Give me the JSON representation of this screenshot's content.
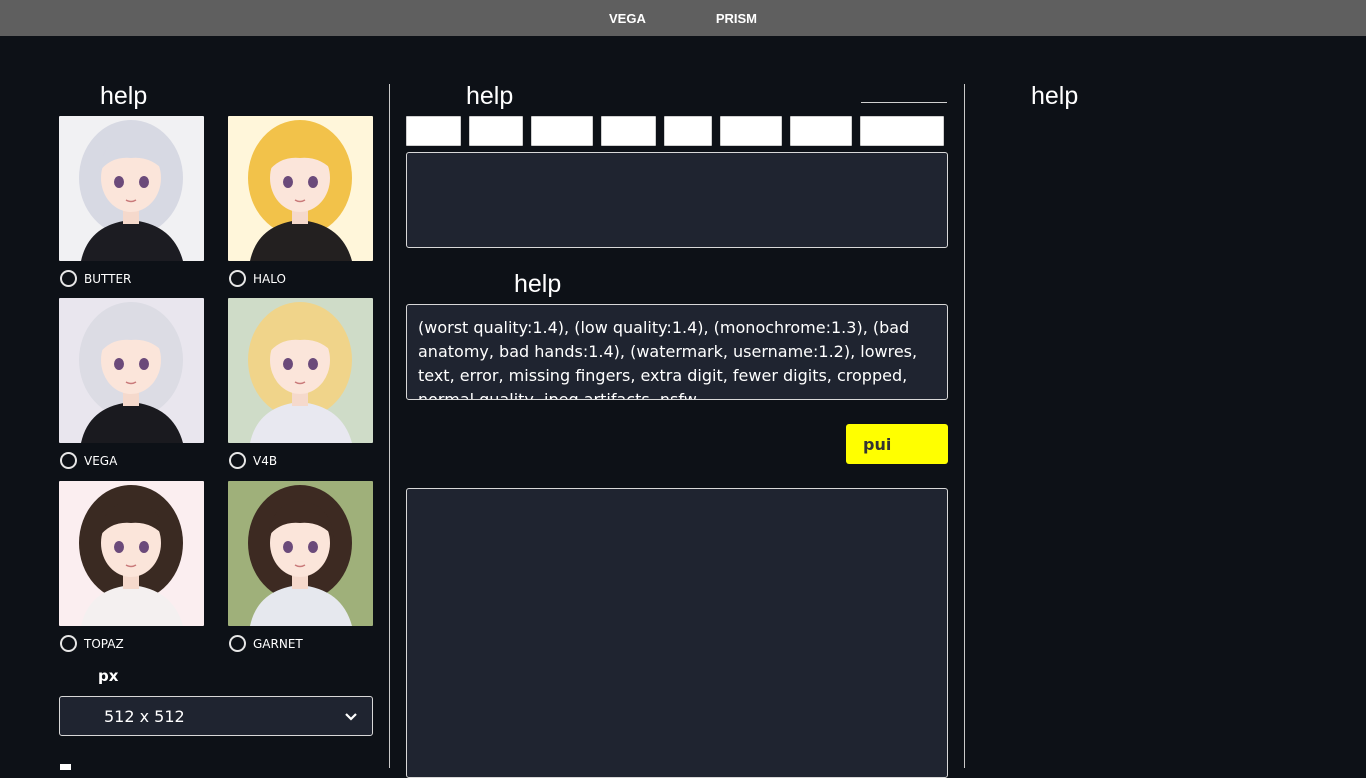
{
  "topbar": {
    "nav": [
      "VEGA",
      "PRISM"
    ]
  },
  "left": {
    "heading": "help",
    "models": [
      {
        "name": "BUTTER",
        "selected": false,
        "hair": "#d7d9e3",
        "bg": "#f1f1f3",
        "dress": "#1c1c22"
      },
      {
        "name": "HALO",
        "selected": false,
        "hair": "#f2c24a",
        "bg": "#fff6da",
        "dress": "#232020"
      },
      {
        "name": "VEGA",
        "selected": false,
        "hair": "#dcdce4",
        "bg": "#e9e6ee",
        "dress": "#1a1a1f"
      },
      {
        "name": "V4B",
        "selected": false,
        "hair": "#f0d48a",
        "bg": "#cfdcc8",
        "dress": "#e8e8f0"
      },
      {
        "name": "TOPAZ",
        "selected": false,
        "hair": "#3a2a22",
        "bg": "#fbeef0",
        "dress": "#f4f0f0"
      },
      {
        "name": "GARNET",
        "selected": false,
        "hair": "#3d2a22",
        "bg": "#9fb07a",
        "dress": "#e6e8ee"
      }
    ],
    "size_label": "px",
    "size_value": "512 x 512"
  },
  "middle": {
    "heading": "help",
    "prompt_text": "",
    "negative_heading": "help",
    "negative_text": "(worst quality:1.4), (low quality:1.4), (monochrome:1.3), (bad anatomy, bad hands:1.4), (watermark, username:1.2), lowres, text, error, missing fingers, extra digit, fewer digits, cropped, normal quality, jpeg artifacts, nsfw",
    "generate_label": "pui"
  },
  "right": {
    "heading": "help"
  },
  "colors": {
    "accent": "#ffff00",
    "panel": "#1f2430",
    "background": "#0d1117",
    "topbar": "#5f5f5f"
  }
}
